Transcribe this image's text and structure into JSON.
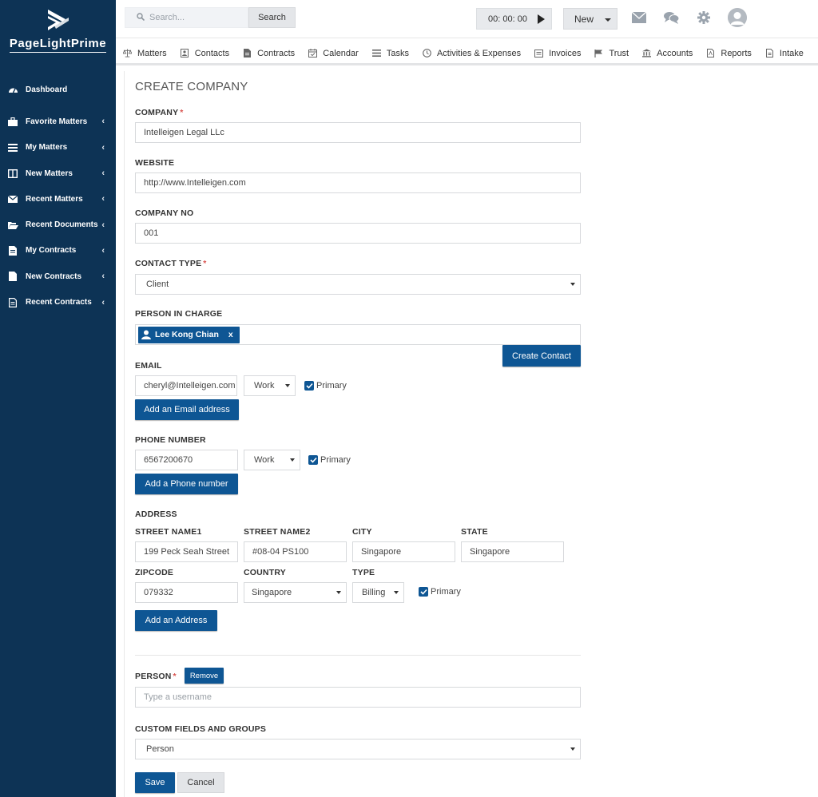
{
  "brand": {
    "name": "PageLightPrime"
  },
  "sidebar": {
    "items": [
      {
        "label": "Dashboard",
        "icon": "dashboard-icon",
        "chevron": ""
      },
      {
        "label": "Favorite Matters",
        "icon": "briefcase-icon",
        "chevron": "‹"
      },
      {
        "label": "My Matters",
        "icon": "list-icon",
        "chevron": "‹"
      },
      {
        "label": "New Matters",
        "icon": "columns-icon",
        "chevron": "‹"
      },
      {
        "label": "Recent Matters",
        "icon": "envelope-icon",
        "chevron": "‹"
      },
      {
        "label": "Recent Documents",
        "icon": "folder-open-icon",
        "chevron": "‹"
      },
      {
        "label": "My Contracts",
        "icon": "document-icon",
        "chevron": "‹"
      },
      {
        "label": "New Contracts",
        "icon": "file-icon",
        "chevron": "‹"
      },
      {
        "label": "Recent Contracts",
        "icon": "file-text-icon",
        "chevron": "‹"
      }
    ]
  },
  "topbar": {
    "search_placeholder": "Search...",
    "search_button": "Search",
    "timer": "00: 00: 00",
    "new_button": "New"
  },
  "modnav": {
    "items": [
      "Matters",
      "Contacts",
      "Contracts",
      "Calendar",
      "Tasks",
      "Activities & Expenses",
      "Invoices",
      "Trust",
      "Accounts",
      "Reports",
      "Intake"
    ]
  },
  "form": {
    "title": "CREATE COMPANY",
    "company_label": "COMPANY",
    "company_value": "Intelleigen Legal LLc",
    "website_label": "WEBSITE",
    "website_value": "http://www.Intelleigen.com",
    "company_no_label": "COMPANY NO",
    "company_no_value": "001",
    "contact_type_label": "CONTACT TYPE",
    "contact_type_value": "Client",
    "person_in_charge_label": "PERSON IN CHARGE",
    "person_in_charge_tag": "Lee Kong Chian",
    "tag_remove": "x",
    "create_contact_button": "Create Contact",
    "email_label": "EMAIL",
    "email_value": "cheryl@Intelleigen.com",
    "email_type": "Work",
    "primary_label": "Primary",
    "add_email_button": "Add an Email address",
    "phone_label": "PHONE NUMBER",
    "phone_value": "6567200670",
    "phone_type": "Work",
    "add_phone_button": "Add a Phone number",
    "address_label": "ADDRESS",
    "street1_label": "STREET NAME1",
    "street1_value": "199 Peck Seah Street",
    "street2_label": "STREET NAME2",
    "street2_value": "#08-04 PS100",
    "city_label": "CITY",
    "city_value": "Singapore",
    "state_label": "STATE",
    "state_value": "Singapore",
    "zipcode_label": "ZIPCODE",
    "zipcode_value": "079332",
    "country_label": "COUNTRY",
    "country_value": "Singapore",
    "type_label": "TYPE",
    "type_value": "Billing",
    "add_address_button": "Add an Address",
    "person_label": "PERSON",
    "remove_button": "Remove",
    "person_placeholder": "Type a username",
    "custom_label": "CUSTOM FIELDS AND GROUPS",
    "custom_value": "Person",
    "save_button": "Save",
    "cancel_button": "Cancel"
  },
  "colors": {
    "sidebar": "#0d3355",
    "primary": "#0e5694",
    "required": "#d9534f"
  }
}
